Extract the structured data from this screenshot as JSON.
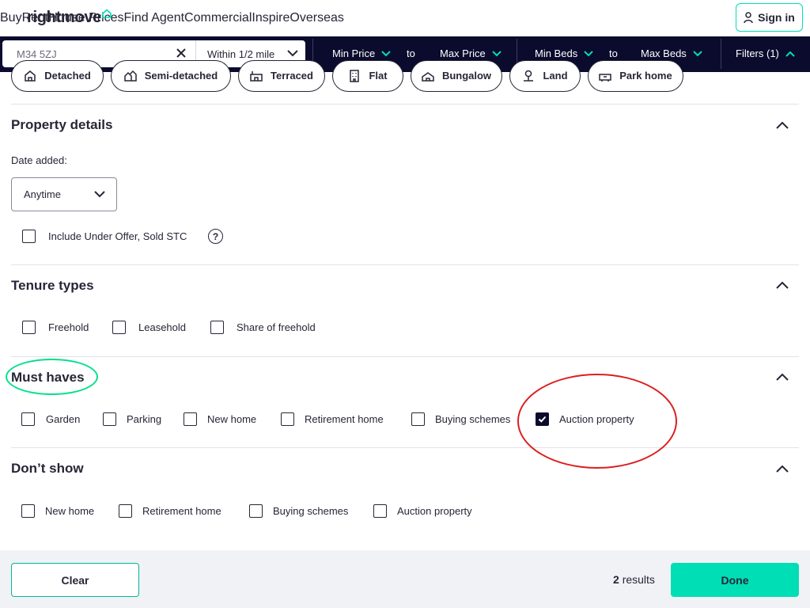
{
  "header": {
    "logo": "rightmove",
    "nav": [
      {
        "label": "Buy"
      },
      {
        "label": "Rent"
      },
      {
        "label": "House Prices"
      },
      {
        "label": "Find Agent"
      },
      {
        "label": "Commercial"
      },
      {
        "label": "Inspire"
      },
      {
        "label": "Overseas"
      }
    ],
    "signin_label": "Sign in"
  },
  "search": {
    "location_value": "M34 5ZJ",
    "radius": "Within 1/2 mile",
    "min_price": "Min Price",
    "price_to": "to",
    "max_price": "Max Price",
    "min_beds": "Min Beds",
    "beds_to": "to",
    "max_beds": "Max Beds",
    "filters": "Filters (1)"
  },
  "property_types": [
    {
      "label": "Detached",
      "icon": "detached-house-icon"
    },
    {
      "label": "Semi-detached",
      "icon": "semi-detached-house-icon"
    },
    {
      "label": "Terraced",
      "icon": "terraced-house-icon"
    },
    {
      "label": "Flat",
      "icon": "flat-building-icon"
    },
    {
      "label": "Bungalow",
      "icon": "bungalow-icon"
    },
    {
      "label": "Land",
      "icon": "land-icon"
    },
    {
      "label": "Park home",
      "icon": "park-home-icon"
    }
  ],
  "property_details": {
    "title": "Property details",
    "date_added_label": "Date added:",
    "date_added_value": "Anytime",
    "include_under_offer": "Include Under Offer, Sold STC",
    "help_glyph": "?"
  },
  "tenure": {
    "title": "Tenure types",
    "options": [
      {
        "label": "Freehold",
        "checked": false
      },
      {
        "label": "Leasehold",
        "checked": false
      },
      {
        "label": "Share of freehold",
        "checked": false
      }
    ]
  },
  "must_haves": {
    "title": "Must haves",
    "options": [
      {
        "label": "Garden",
        "checked": false
      },
      {
        "label": "Parking",
        "checked": false
      },
      {
        "label": "New home",
        "checked": false
      },
      {
        "label": "Retirement home",
        "checked": false
      },
      {
        "label": "Buying schemes",
        "checked": false
      },
      {
        "label": "Auction property",
        "checked": true
      }
    ]
  },
  "dont_show": {
    "title": "Don’t show",
    "options": [
      {
        "label": "New home",
        "checked": false
      },
      {
        "label": "Retirement home",
        "checked": false
      },
      {
        "label": "Buying schemes",
        "checked": false
      },
      {
        "label": "Auction property",
        "checked": false
      }
    ]
  },
  "footer": {
    "clear_label": "Clear",
    "results_count": "2",
    "results_suffix": "results",
    "done_label": "Done"
  },
  "colors": {
    "brand_teal": "#00deb6",
    "navy": "#0b0b2e",
    "annotation_green": "#00e08a",
    "annotation_red": "#dc1f1f"
  }
}
